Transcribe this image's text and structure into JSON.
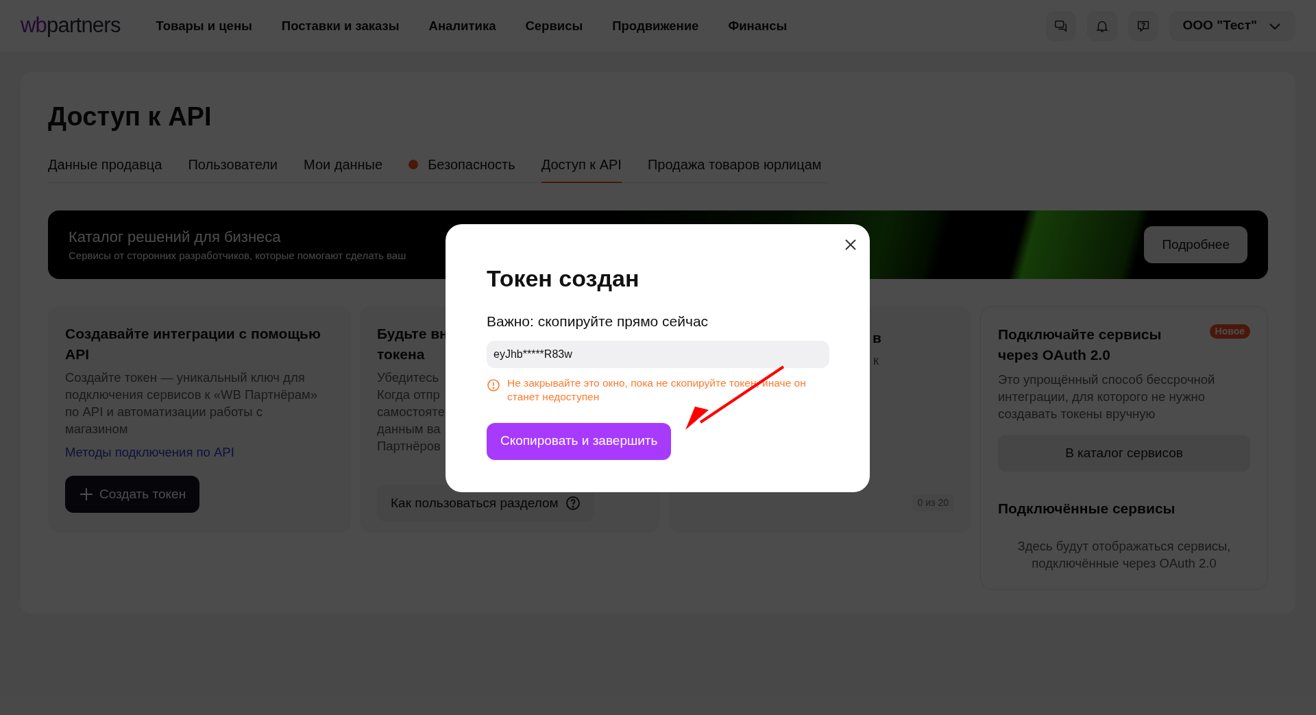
{
  "header": {
    "logo_accent": "wb",
    "logo_rest": "partners",
    "nav": [
      "Товары и цены",
      "Поставки и заказы",
      "Аналитика",
      "Сервисы",
      "Продвижение",
      "Финансы"
    ],
    "account": "ООО \"Тест\""
  },
  "page": {
    "title": "Доступ к API",
    "tabs": [
      {
        "label": "Данные продавца",
        "selected": false,
        "alert": false
      },
      {
        "label": "Пользователи",
        "selected": false,
        "alert": false
      },
      {
        "label": "Мои данные",
        "selected": false,
        "alert": false
      },
      {
        "label": "Безопасность",
        "selected": false,
        "alert": true
      },
      {
        "label": "Доступ к API",
        "selected": true,
        "alert": false
      },
      {
        "label": "Продажа товаров юрлицам",
        "selected": false,
        "alert": false
      }
    ]
  },
  "banner": {
    "title": "Каталог решений для бизнеса",
    "subtitle": "Сервисы от сторонних разработчиков, которые помогают сделать ваш",
    "button": "Подробнее"
  },
  "cards": [
    {
      "kind": "integration",
      "title": "Создавайте интеграции с помощью API",
      "text": "Создайте токен — уникальный ключ для подключения сервисов к «WB Партнёрам» по API и автоматизации работы с магазином",
      "link": "Методы подключения по API",
      "button": "Создать токен"
    },
    {
      "kind": "guide",
      "title_lines": [
        "Будьте вн",
        "токена"
      ],
      "text_lines": [
        "Убедитесь",
        "Когда отпр",
        "самостояте",
        "данным ва",
        "Партнёров"
      ],
      "button": "Как пользоваться разделом"
    },
    {
      "kind": "list",
      "title": "в",
      "text": "к",
      "counter": "0 из 20"
    }
  ],
  "oauth": {
    "title": "Подключайте сервисы через OAuth 2.0",
    "badge": "Новое",
    "text": "Это упрощённый способ бессрочной интеграции, для которого не нужно создавать токены вручную",
    "button": "В каталог сервисов",
    "connected_title": "Подключённые сервисы",
    "connected_empty": "Здесь будут отображаться сервисы, подключённые через OAuth 2.0"
  },
  "modal": {
    "title": "Токен создан",
    "label": "Важно: скопируйте прямо сейчас",
    "token": "eyJhb*****R83w",
    "warning": "Не закрывайте это окно, пока не скопируйте токен, иначе он станет недоступен",
    "button": "Скопировать и завершить"
  }
}
